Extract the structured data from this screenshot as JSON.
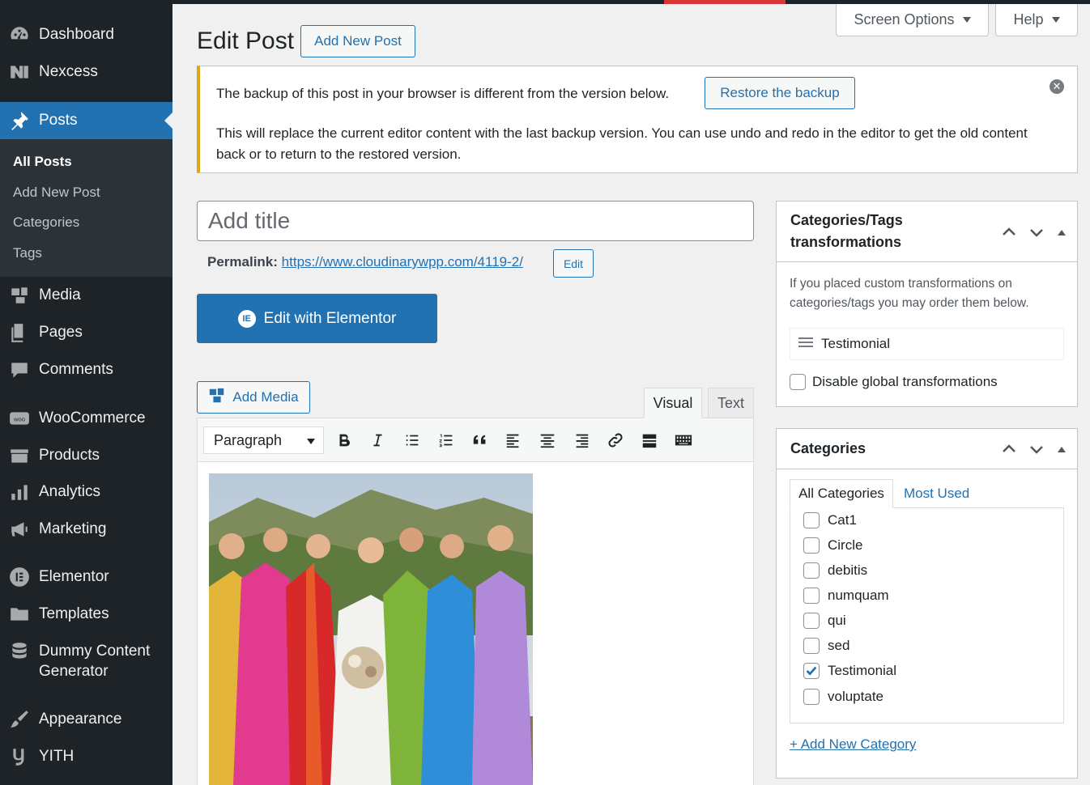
{
  "sidebar": {
    "items": [
      {
        "key": "dashboard",
        "label": "Dashboard",
        "icon": "dashboard-icon"
      },
      {
        "key": "nexcess",
        "label": "Nexcess",
        "icon": "nexcess-icon"
      },
      {
        "key": "posts",
        "label": "Posts",
        "icon": "pin-icon"
      },
      {
        "key": "media",
        "label": "Media",
        "icon": "media-icon"
      },
      {
        "key": "pages",
        "label": "Pages",
        "icon": "pages-icon"
      },
      {
        "key": "comments",
        "label": "Comments",
        "icon": "comments-icon"
      },
      {
        "key": "woocommerce",
        "label": "WooCommerce",
        "icon": "woocommerce-icon"
      },
      {
        "key": "products",
        "label": "Products",
        "icon": "products-icon"
      },
      {
        "key": "analytics",
        "label": "Analytics",
        "icon": "analytics-icon"
      },
      {
        "key": "marketing",
        "label": "Marketing",
        "icon": "megaphone-icon"
      },
      {
        "key": "elementor",
        "label": "Elementor",
        "icon": "elementor-icon"
      },
      {
        "key": "templates",
        "label": "Templates",
        "icon": "folder-icon"
      },
      {
        "key": "dummy",
        "label": "Dummy Content",
        "label2": "Generator",
        "icon": "database-icon"
      },
      {
        "key": "appearance",
        "label": "Appearance",
        "icon": "brush-icon"
      },
      {
        "key": "yith",
        "label": "YITH",
        "icon": "yith-icon"
      }
    ],
    "submenu": [
      "All Posts",
      "Add New Post",
      "Categories",
      "Tags"
    ]
  },
  "header": {
    "title": "Edit Post",
    "add_new": "Add New Post",
    "screen_options": "Screen Options",
    "help": "Help"
  },
  "notice": {
    "message": "The backup of this post in your browser is different from the version below.",
    "restore_label": "Restore the backup",
    "detail": "This will replace the current editor content with the last backup version. You can use undo and redo in the editor to get the old content back or to return to the restored version.",
    "close": "✕"
  },
  "editor": {
    "title_placeholder": "Add title",
    "permalink_label": "Permalink:",
    "permalink_url": "https://www.cloudinarywpp.com/4119-2/",
    "permalink_edit": "Edit",
    "elementor_label": "Edit with Elementor",
    "add_media": "Add Media",
    "tab_visual": "Visual",
    "tab_text": "Text",
    "format": "Paragraph"
  },
  "transform_panel": {
    "title_line1": "Categories/Tags",
    "title_line2": "transformations",
    "description": "If you placed custom transformations on categories/tags you may order them below.",
    "item": "Testimonial",
    "disable_label": "Disable global transformations"
  },
  "categories_panel": {
    "title": "Categories",
    "tab_all": "All Categories",
    "tab_most_used": "Most Used",
    "items": [
      {
        "label": "Cat1",
        "checked": false
      },
      {
        "label": "Circle",
        "checked": false
      },
      {
        "label": "debitis",
        "checked": false
      },
      {
        "label": "numquam",
        "checked": false
      },
      {
        "label": "qui",
        "checked": false
      },
      {
        "label": "sed",
        "checked": false
      },
      {
        "label": "Testimonial",
        "checked": true
      },
      {
        "label": "voluptate",
        "checked": false
      }
    ],
    "add_new": "+ Add New Category"
  },
  "colors": {
    "accent": "#2271b1",
    "sidebar": "#1d2327",
    "notice_warning": "#dba617"
  }
}
